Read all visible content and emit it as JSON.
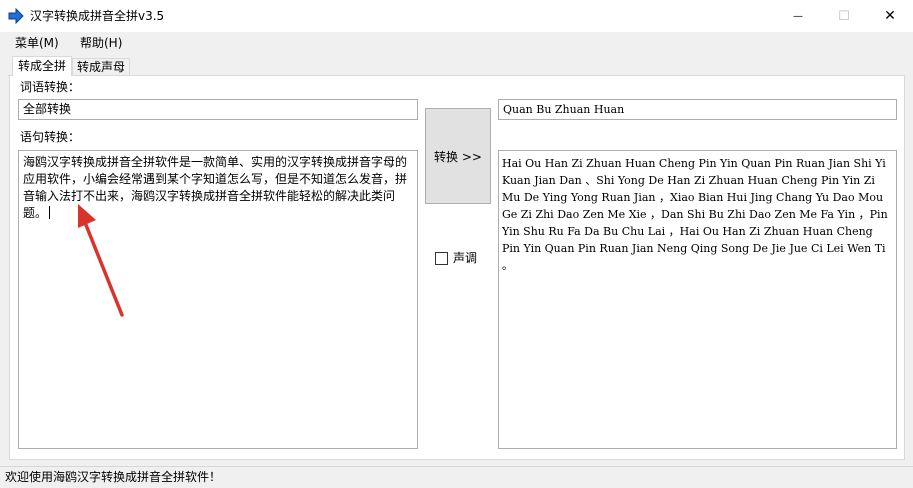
{
  "window": {
    "title": "汉字转换成拼音全拼v3.5",
    "minimize_glyph": "—",
    "maximize_glyph": "☐",
    "close_glyph": "✕"
  },
  "menu": {
    "items": [
      {
        "label": "菜单(M)"
      },
      {
        "label": "帮助(H)"
      }
    ]
  },
  "tabs": [
    {
      "label": "转成全拼",
      "active": true
    },
    {
      "label": "转成声母",
      "active": false
    }
  ],
  "word": {
    "label": "词语转换：",
    "input_value": "全部转换",
    "output_value": "Quan Bu Zhuan Huan"
  },
  "sentence": {
    "label": "语句转换：",
    "input_value": "海鸥汉字转换成拼音全拼软件是一款简单、实用的汉字转换成拼音字母的应用软件，小编会经常遇到某个字知道怎么写，但是不知道怎么发音，拼音输入法打不出来，海鸥汉字转换成拼音全拼软件能轻松的解决此类问题。",
    "output_value": "Hai Ou Han Zi Zhuan Huan Cheng Pin Yin Quan Pin Ruan Jian Shi Yi Kuan Jian Dan 、Shi Yong De Han Zi Zhuan Huan Cheng Pin Yin Zi Mu De Ying Yong Ruan Jian ，Xiao Bian Hui Jing Chang Yu Dao Mou Ge Zi Zhi Dao Zen Me Xie ，Dan Shi Bu Zhi Dao Zen Me Fa Yin ，Pin Yin Shu Ru Fa Da Bu Chu Lai ，Hai Ou Han Zi Zhuan Huan Cheng Pin Yin Quan Pin Ruan Jian Neng Qing Song De Jie Jue Ci Lei Wen Ti 。"
  },
  "convert_button": {
    "label": "转换 >>"
  },
  "tone_checkbox": {
    "label": "声调",
    "checked": false
  },
  "status": {
    "text": "欢迎使用海鸥汉字转换成拼音全拼软件！"
  },
  "colors": {
    "arrow": "#d9342b",
    "accent": "#1e6fd9"
  },
  "icons": {
    "app": "arrow-right-icon",
    "annotation": "red-arrow-annotation"
  }
}
